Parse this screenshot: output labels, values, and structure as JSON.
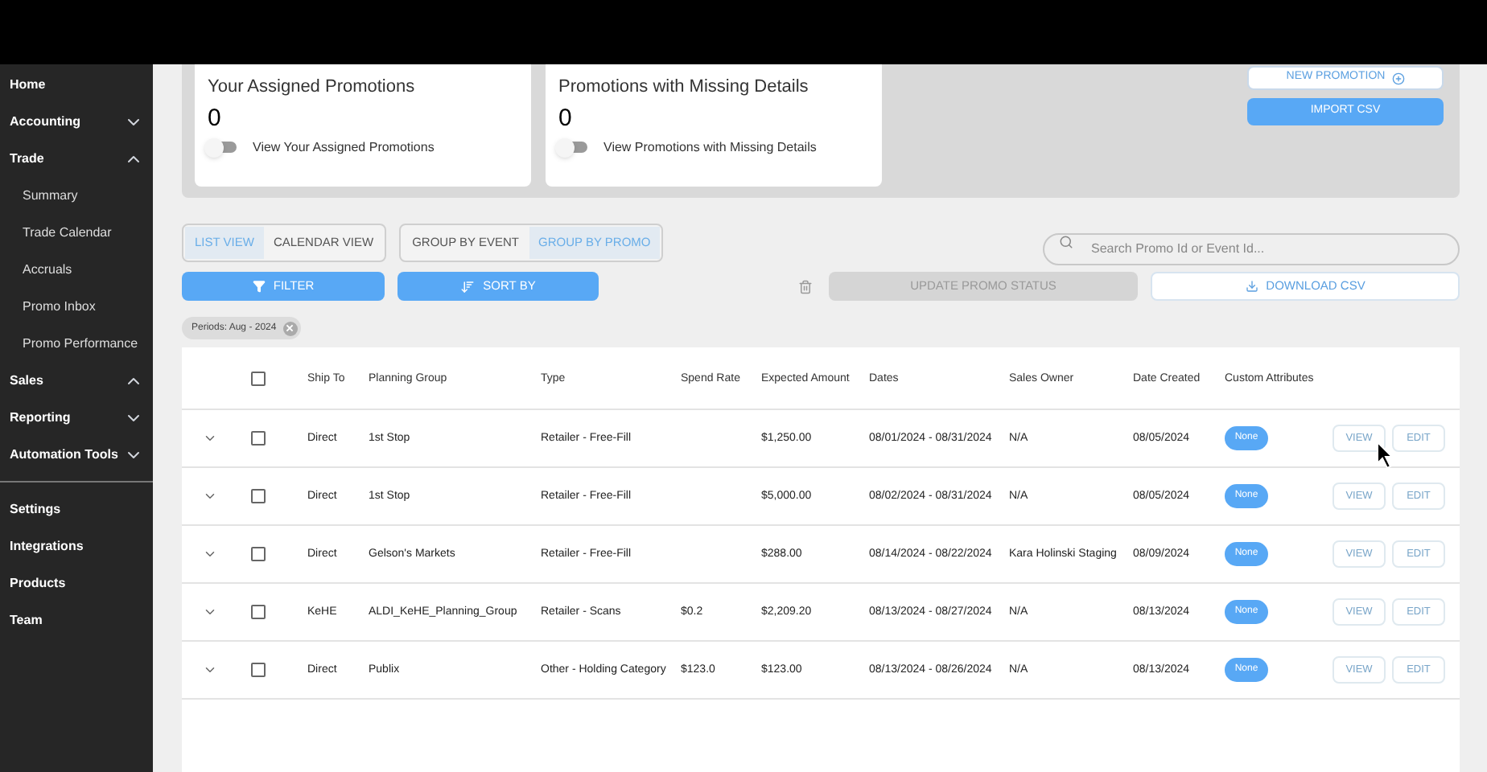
{
  "sidebar": {
    "items": [
      {
        "label": "Home"
      },
      {
        "label": "Accounting",
        "expanded": false
      },
      {
        "label": "Trade",
        "expanded": true,
        "children": [
          {
            "label": "Summary"
          },
          {
            "label": "Trade Calendar"
          },
          {
            "label": "Accruals"
          },
          {
            "label": "Promo Inbox"
          },
          {
            "label": "Promo Performance"
          }
        ]
      },
      {
        "label": "Sales",
        "expanded": true
      },
      {
        "label": "Reporting",
        "expanded": false
      },
      {
        "label": "Automation Tools",
        "expanded": false
      }
    ],
    "bottom_items": [
      {
        "label": "Settings"
      },
      {
        "label": "Integrations"
      },
      {
        "label": "Products"
      },
      {
        "label": "Team"
      }
    ]
  },
  "summary_cards": [
    {
      "title": "Your Assigned Promotions",
      "count": "0",
      "toggle": {
        "label": "View Your Assigned Promotions",
        "on": false
      }
    },
    {
      "title": "Promotions with Missing Details",
      "count": "0",
      "toggle": {
        "label": "View Promotions with Missing Details",
        "on": false
      }
    }
  ],
  "header_buttons": {
    "new_promotion": "NEW PROMOTION",
    "import_csv": "IMPORT CSV"
  },
  "view_toggle": [
    {
      "label": "LIST VIEW",
      "selected": true
    },
    {
      "label": "CALENDAR VIEW",
      "selected": false
    }
  ],
  "group_toggle": [
    {
      "label": "GROUP BY EVENT",
      "selected": false
    },
    {
      "label": "GROUP BY PROMO",
      "selected": true
    }
  ],
  "search": {
    "placeholder": "Search Promo Id or Event Id..."
  },
  "toolbar": {
    "filter": "FILTER",
    "sort": "SORT BY",
    "update_status": {
      "label": "UPDATE PROMO STATUS",
      "disabled": true
    },
    "download": "DOWNLOAD CSV"
  },
  "filter_chips": [
    {
      "label": "Periods: Aug - 2024"
    }
  ],
  "table": {
    "select_all_checked": false,
    "columns": [
      "Ship To",
      "Planning Group",
      "Type",
      "Spend Rate",
      "Expected Amount",
      "Dates",
      "Sales Owner",
      "Date Created",
      "Custom Attributes"
    ],
    "rows": [
      {
        "cells": [
          "Direct",
          "1st Stop",
          "Retailer - Free-Fill",
          "",
          "$1,250.00",
          "08/01/2024 - 08/31/2024",
          "N/A",
          "08/05/2024"
        ],
        "badge": "None",
        "checked": false,
        "actions": [
          "VIEW",
          "EDIT"
        ]
      },
      {
        "cells": [
          "Direct",
          "1st Stop",
          "Retailer - Free-Fill",
          "",
          "$5,000.00",
          "08/02/2024 - 08/31/2024",
          "N/A",
          "08/05/2024"
        ],
        "badge": "None",
        "checked": false,
        "actions": [
          "VIEW",
          "EDIT"
        ]
      },
      {
        "cells": [
          "Direct",
          "Gelson's Markets",
          "Retailer - Free-Fill",
          "",
          "$288.00",
          "08/14/2024 - 08/22/2024",
          "Kara Holinski Staging",
          "08/09/2024"
        ],
        "badge": "None",
        "checked": false,
        "actions": [
          "VIEW",
          "EDIT"
        ]
      },
      {
        "cells": [
          "KeHE",
          "ALDI_KeHE_Planning_Group",
          "Retailer - Scans",
          "$0.2",
          "$2,209.20",
          "08/13/2024 - 08/27/2024",
          "N/A",
          "08/13/2024"
        ],
        "badge": "None",
        "checked": false,
        "actions": [
          "VIEW",
          "EDIT"
        ]
      },
      {
        "cells": [
          "Direct",
          "Publix",
          "Other - Holding Category",
          "$123.0",
          "$123.00",
          "08/13/2024 - 08/26/2024",
          "N/A",
          "08/13/2024"
        ],
        "badge": "None",
        "checked": false,
        "actions": [
          "VIEW",
          "EDIT"
        ]
      }
    ]
  }
}
